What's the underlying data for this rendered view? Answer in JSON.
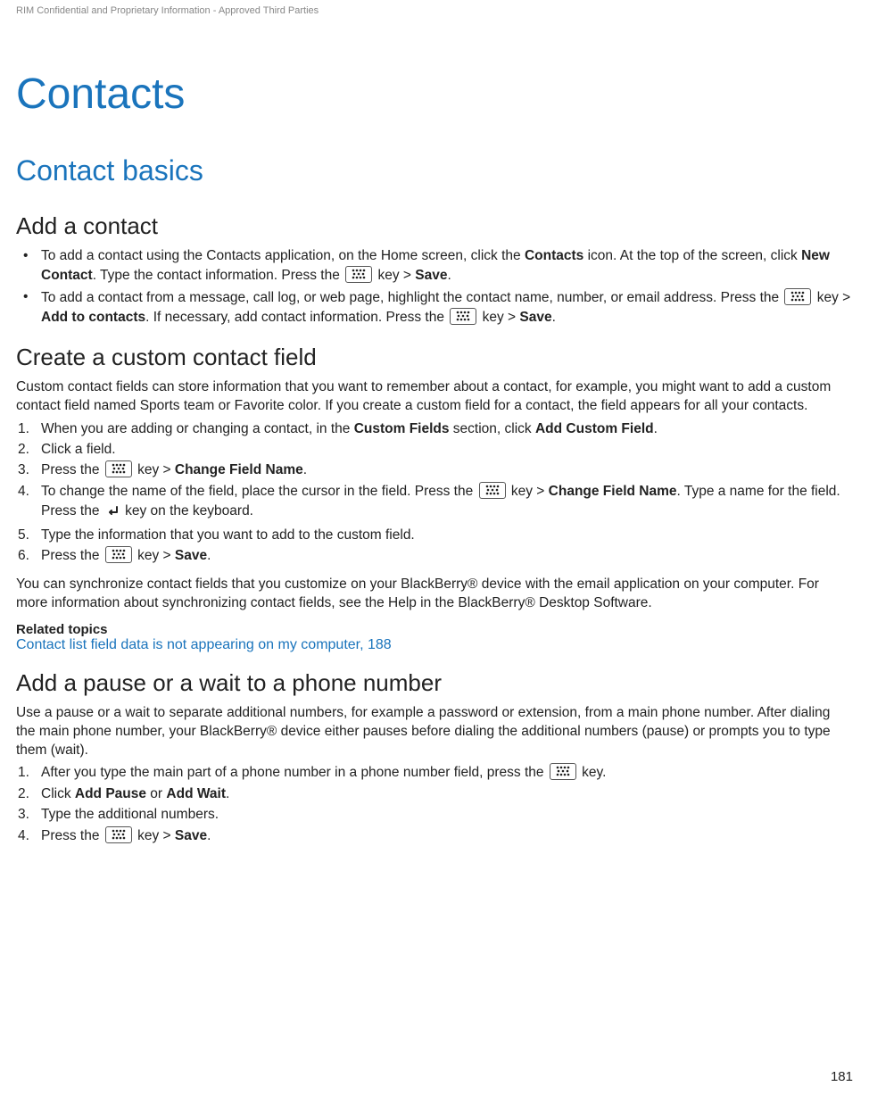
{
  "header_notice": "RIM Confidential and Proprietary Information - Approved Third Parties",
  "title": "Contacts",
  "section1": "Contact basics",
  "add_contact": {
    "heading": "Add a contact",
    "b1_a": "To add a contact using the Contacts application, on the Home screen, click the ",
    "b1_b": "Contacts",
    "b1_c": " icon. At the top of the screen, click ",
    "b1_d": "New Contact",
    "b1_e": ". Type the contact information. Press the ",
    "b1_f": " key > ",
    "b1_g": "Save",
    "b1_h": ".",
    "b2_a": "To add a contact from a message, call log, or web page, highlight the contact name, number, or email address. Press the ",
    "b2_b": " key > ",
    "b2_c": "Add to contacts",
    "b2_d": ". If necessary, add contact information. Press the ",
    "b2_e": " key > ",
    "b2_f": "Save",
    "b2_g": "."
  },
  "custom_field": {
    "heading": "Create a custom contact field",
    "intro": "Custom contact fields can store information that you want to remember about a contact, for example, you might want to add a custom contact field named Sports team or Favorite color. If you create a custom field for a contact, the field appears for all your contacts.",
    "s1_a": "When you are adding or changing a contact, in the ",
    "s1_b": "Custom Fields",
    "s1_c": " section, click ",
    "s1_d": "Add Custom Field",
    "s1_e": ".",
    "s2": "Click a field.",
    "s3_a": "Press the ",
    "s3_b": " key > ",
    "s3_c": "Change Field Name",
    "s3_d": ".",
    "s4_a": "To change the name of the field, place the cursor in the field. Press the ",
    "s4_b": " key > ",
    "s4_c": "Change Field Name",
    "s4_d": ". Type a name for the field. Press the ",
    "s4_e": " key on the keyboard.",
    "s5": "Type the information that you want to add to the custom field.",
    "s6_a": "Press the ",
    "s6_b": " key > ",
    "s6_c": "Save",
    "s6_d": ".",
    "outro": "You can synchronize contact fields that you customize on your BlackBerry® device with the email application on your computer. For more information about synchronizing contact fields, see the Help in the BlackBerry® Desktop Software.",
    "related_heading": "Related topics",
    "related_link": "Contact list field data is not appearing on my computer, 188"
  },
  "pause_wait": {
    "heading": "Add a pause or a wait to a phone number",
    "intro": "Use a pause or a wait to separate additional numbers, for example a password or extension, from a main phone number. After dialing the main phone number, your BlackBerry® device either pauses before dialing the additional numbers (pause) or prompts you to type them (wait).",
    "s1_a": "After you type the main part of a phone number in a phone number field, press the ",
    "s1_b": " key.",
    "s2_a": "Click ",
    "s2_b": "Add Pause",
    "s2_c": " or ",
    "s2_d": "Add Wait",
    "s2_e": ".",
    "s3": "Type the additional numbers.",
    "s4_a": "Press the ",
    "s4_b": " key > ",
    "s4_c": "Save",
    "s4_d": "."
  },
  "page_number": "181"
}
